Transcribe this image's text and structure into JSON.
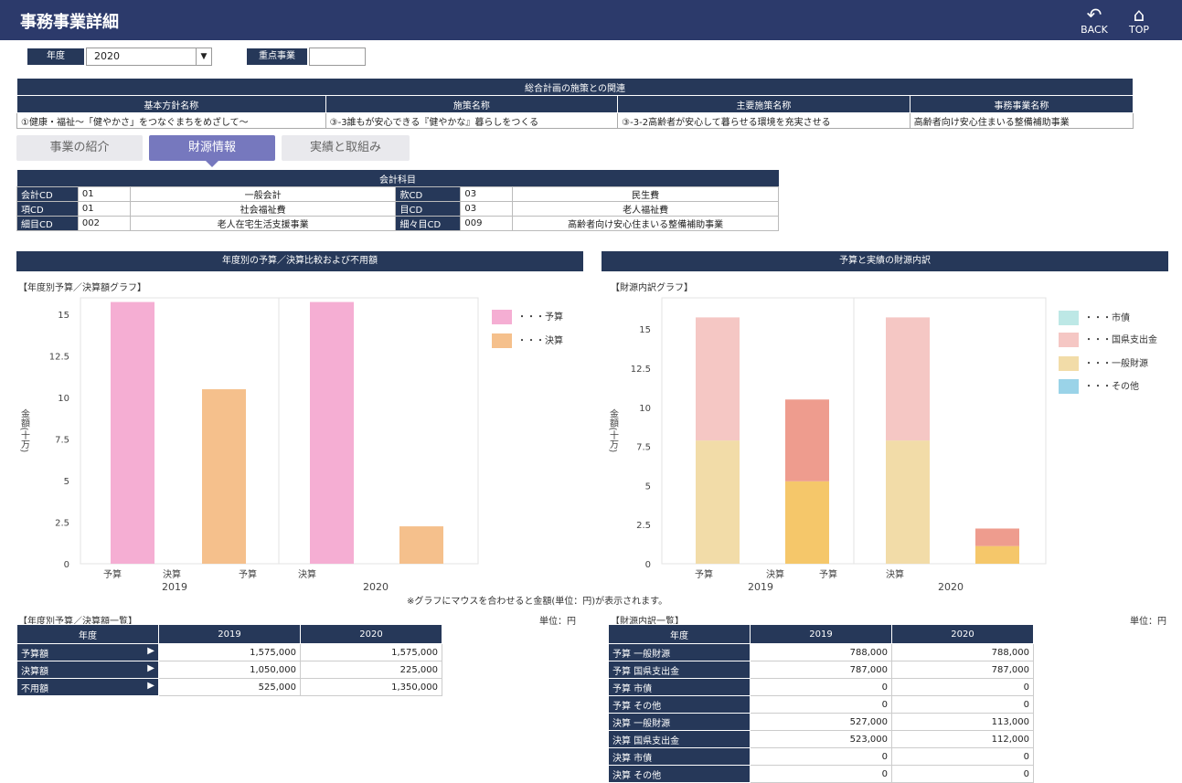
{
  "header": {
    "title": "事務事業詳細",
    "back": "BACK",
    "top": "TOP"
  },
  "filters": {
    "year_label": "年度",
    "year_value": "2020",
    "priority_label": "重点事業",
    "priority_value": ""
  },
  "relation": {
    "title": "総合計画の施策との関連",
    "headers": [
      "基本方針名称",
      "施策名称",
      "主要施策名称",
      "事務事業名称"
    ],
    "values": [
      "①健康・福祉～「健やかさ」をつなぐまちをめざして～",
      "③-3誰もが安心できる『健やかな』暮らしをつくる",
      "③-3-2高齢者が安心して暮らせる環境を充実させる",
      "高齢者向け安心住まいる整備補助事業"
    ]
  },
  "tabs": [
    "事業の紹介",
    "財源情報",
    "実績と取組み"
  ],
  "account": {
    "title": "会計科目",
    "rows": [
      [
        "会計CD",
        "01",
        "一般会計",
        "款CD",
        "03",
        "民生費"
      ],
      [
        "項CD",
        "01",
        "社会福祉費",
        "目CD",
        "03",
        "老人福祉費"
      ],
      [
        "細目CD",
        "002",
        "老人在宅生活支援事業",
        "細々目CD",
        "009",
        "高齢者向け安心住まいる整備補助事業"
      ]
    ]
  },
  "left_section": {
    "title": "年度別の予算／決算比較および不用額",
    "caption": "【年度別予算／決算額グラフ】",
    "legend": [
      "・・・予算",
      "・・・決算"
    ]
  },
  "right_section": {
    "title": "予算と実績の財源内訳",
    "caption": "【財源内訳グラフ】",
    "legend": [
      "・・・市債",
      "・・・国県支出金",
      "・・・一般財源",
      "・・・その他"
    ]
  },
  "note": "※グラフにマウスを合わせると金額(単位：円)が表示されます。",
  "colors": {
    "budget": "#f5aed3",
    "actual": "#f5c08c",
    "navy": "#263859",
    "tab_active": "#7678be",
    "bond": "#bde8e6",
    "grant_budget": "#f5c7c4",
    "grant_actual": "#ee9c8e",
    "general_budget": "#f2dca8",
    "general_actual": "#f5c76a",
    "other": "#9ad3e8"
  },
  "chart_data": [
    {
      "type": "bar",
      "ylabel": "金額(十万)",
      "ylim": [
        0,
        16
      ],
      "yticks": [
        "0",
        "2.5",
        "5",
        "7.5",
        "10",
        "12.5",
        "15"
      ],
      "groups": [
        "2019",
        "2020"
      ],
      "categories": [
        "予算",
        "決算",
        "予算",
        "決算"
      ],
      "series": [
        {
          "name": "予算",
          "values": [
            15.75,
            15.75
          ]
        },
        {
          "name": "決算",
          "values": [
            10.5,
            2.25
          ]
        }
      ]
    },
    {
      "type": "bar",
      "stacked": true,
      "ylabel": "金額(十万)",
      "ylim": [
        0,
        17
      ],
      "yticks": [
        "0",
        "2.5",
        "5",
        "7.5",
        "10",
        "12.5",
        "15"
      ],
      "groups": [
        "2019",
        "2020"
      ],
      "categories": [
        "予算",
        "決算",
        "予算",
        "決算"
      ],
      "series": [
        {
          "name": "一般財源",
          "values": [
            7.88,
            5.27,
            7.88,
            1.13
          ]
        },
        {
          "name": "国県支出金",
          "values": [
            7.87,
            5.23,
            7.87,
            1.12
          ]
        },
        {
          "name": "市債",
          "values": [
            0,
            0,
            0,
            0
          ]
        },
        {
          "name": "その他",
          "values": [
            0,
            0,
            0,
            0
          ]
        }
      ]
    }
  ],
  "table1": {
    "caption": "【年度別予算／決算額一覧】",
    "unit": "単位：円",
    "headers": [
      "年度",
      "2019",
      "2020"
    ],
    "rows": [
      {
        "label": "予算額",
        "v": [
          "1,575,000",
          "1,575,000"
        ]
      },
      {
        "label": "決算額",
        "v": [
          "1,050,000",
          "225,000"
        ]
      },
      {
        "label": "不用額",
        "v": [
          "525,000",
          "1,350,000"
        ]
      }
    ]
  },
  "table2": {
    "caption": "【財源内訳一覧】",
    "unit": "単位：円",
    "headers": [
      "年度",
      "2019",
      "2020"
    ],
    "rows": [
      {
        "label": "予算 一般財源",
        "v": [
          "788,000",
          "788,000"
        ]
      },
      {
        "label": "予算 国県支出金",
        "v": [
          "787,000",
          "787,000"
        ]
      },
      {
        "label": "予算 市債",
        "v": [
          "0",
          "0"
        ]
      },
      {
        "label": "予算 その他",
        "v": [
          "0",
          "0"
        ]
      },
      {
        "label": "決算 一般財源",
        "v": [
          "527,000",
          "113,000"
        ]
      },
      {
        "label": "決算 国県支出金",
        "v": [
          "523,000",
          "112,000"
        ]
      },
      {
        "label": "決算 市債",
        "v": [
          "0",
          "0"
        ]
      },
      {
        "label": "決算 その他",
        "v": [
          "0",
          "0"
        ]
      }
    ]
  }
}
